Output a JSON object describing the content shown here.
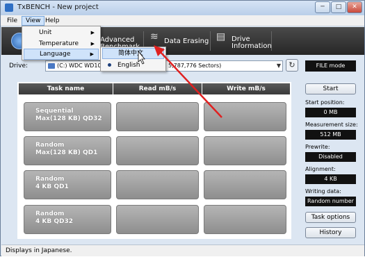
{
  "window": {
    "title": "TxBENCH - New project",
    "controls": [
      "─",
      "□",
      "✕"
    ]
  },
  "menubar": {
    "items": [
      "File",
      "View",
      "Help"
    ]
  },
  "toolbar": {
    "advanced_line1": "Advanced",
    "advanced_line2": "Benchmark",
    "erasing": "Data Erasing",
    "info_line1": "Drive",
    "info_line2": "Information"
  },
  "view_menu": {
    "items": [
      "Unit",
      "Temperature",
      "Language"
    ]
  },
  "language_menu": {
    "items": [
      "简体中文",
      "English"
    ],
    "selected": "English"
  },
  "drive": {
    "label": "Drive:",
    "value_prefix": "(C:) WDC WD10E",
    "value_suffix": "5,787,776 Sectors)",
    "refresh_icon": "refresh-icon"
  },
  "mode": "FILE mode",
  "table": {
    "headers": [
      "Task name",
      "Read mB/s",
      "Write mB/s"
    ],
    "rows": [
      {
        "line1": "Sequential",
        "line2": "Max(128 KB) QD32"
      },
      {
        "line1": "Random",
        "line2": "Max(128 KB) QD1"
      },
      {
        "line1": "Random",
        "line2": "4 KB QD1"
      },
      {
        "line1": "Random",
        "line2": "4 KB QD32"
      }
    ]
  },
  "panel": {
    "start": "Start",
    "start_position_label": "Start position:",
    "start_position": "0 MB",
    "measurement_size_label": "Measurement size:",
    "measurement_size": "512 MB",
    "prewrite_label": "Prewrite:",
    "prewrite": "Disabled",
    "alignment_label": "Alignment:",
    "alignment": "4 KB",
    "writing_data_label": "Writing data:",
    "writing_data": "Random number",
    "task_options": "Task options",
    "history": "History"
  },
  "status": "Displays in Japanese.",
  "colors": {
    "annotation_arrow": "#e02020",
    "toolbar_bg": "#2e2e2e",
    "menu_highlight": "#cfe3fa"
  }
}
